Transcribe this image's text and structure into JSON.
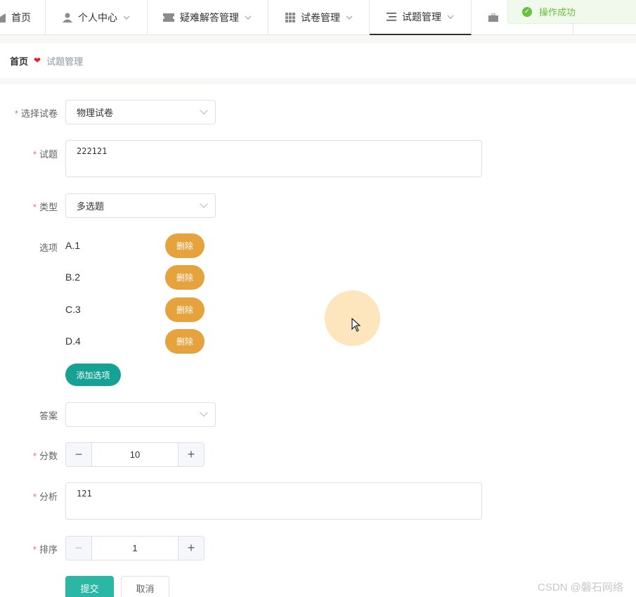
{
  "nav": {
    "items": [
      {
        "label": "首页",
        "icon": "home-icon",
        "dropdown": false
      },
      {
        "label": "个人中心",
        "icon": "user-icon",
        "dropdown": true
      },
      {
        "label": "疑难解答管理",
        "icon": "ticket-icon",
        "dropdown": true
      },
      {
        "label": "试卷管理",
        "icon": "grid-icon",
        "dropdown": true
      },
      {
        "label": "试题管理",
        "icon": "list-icon",
        "dropdown": true,
        "active": true
      }
    ]
  },
  "toast": {
    "message": "操作成功",
    "icon": "success-check-icon",
    "color": "#67c23a"
  },
  "breadcrumb": {
    "home": "首页",
    "separator_icon": "heart-icon",
    "current": "试题管理"
  },
  "form": {
    "paper": {
      "label": "选择试卷",
      "required": true,
      "value": "物理试卷"
    },
    "question": {
      "label": "试题",
      "required": true,
      "value": "222121"
    },
    "type": {
      "label": "类型",
      "required": true,
      "value": "多选题"
    },
    "options": {
      "label": "选项",
      "items": [
        "A.1",
        "B.2",
        "C.3",
        "D.4"
      ],
      "delete_label": "删除",
      "add_label": "添加选项"
    },
    "answer": {
      "label": "答案",
      "required": false,
      "value": ""
    },
    "score": {
      "label": "分数",
      "required": true,
      "value": "10"
    },
    "analysis": {
      "label": "分析",
      "required": true,
      "value": "121"
    },
    "sort": {
      "label": "排序",
      "required": true,
      "value": "1"
    },
    "submit_label": "提交",
    "cancel_label": "取消"
  },
  "watermark": "CSDN @磐石网络",
  "colors": {
    "delete": "#e6a23c",
    "primary": "#15a193",
    "required": "#f56c6c"
  }
}
